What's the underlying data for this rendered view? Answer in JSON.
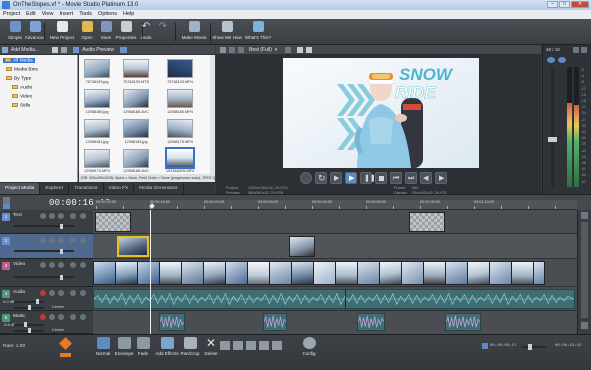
{
  "window": {
    "title": "OnTheSlopes.vf * - Movie Studio Platinum 13.0",
    "buttons": [
      "–",
      "□",
      "✕"
    ]
  },
  "menu": [
    "Project",
    "Edit",
    "View",
    "Insert",
    "Tools",
    "Options",
    "Help"
  ],
  "toolbar": {
    "items": [
      {
        "label": "Simple",
        "icon": "layout-simple-icon"
      },
      {
        "label": "Advanced",
        "icon": "layout-advanced-icon"
      },
      {
        "label": "New Project",
        "icon": "new-project-icon"
      },
      {
        "label": "Open",
        "icon": "open-folder-icon"
      },
      {
        "label": "Save",
        "icon": "save-icon"
      },
      {
        "label": "Properties",
        "icon": "properties-icon"
      },
      {
        "label": "Undo",
        "icon": "undo-icon"
      },
      {
        "label": "Make Movie",
        "icon": "make-movie-icon"
      },
      {
        "label": "Show Me How",
        "icon": "show-me-how-icon"
      },
      {
        "label": "What's This?",
        "icon": "help-icon"
      }
    ]
  },
  "media": {
    "add_media_label": "Add Media...",
    "audio_preview_label": "Audio Preview",
    "tree": [
      {
        "label": "All Media",
        "selected": true
      },
      {
        "label": "Media Bins",
        "selected": false
      },
      {
        "label": "By Type",
        "selected": false
      },
      {
        "label": "Audio",
        "selected": false
      },
      {
        "label": "Video",
        "selected": false
      },
      {
        "label": "Stills",
        "selected": false
      }
    ],
    "thumbnails": [
      "75748193.jpg",
      "75748193.MTS",
      "75748193.MP4",
      "12958185.jpg",
      "12958185.AVC",
      "12958185.MP4",
      "12958181.jpg",
      "12958183.jpg",
      "12958175.MP4",
      "12958174.MP4",
      "12958188.AVC",
      "10316480S.MP4"
    ],
    "info_line": "DIR: 400x400x32/IN, Alpha = None, Field Order = None (progressive scan), JPEG Quality",
    "tabs": [
      "Project Media",
      "Explorer",
      "Transitions",
      "Video FX",
      "Media Generators"
    ]
  },
  "preview": {
    "mode_label": "Best (Full)",
    "overlay_text_1": "SNOW",
    "overlay_text_2": "RIDE",
    "info": {
      "project_label": "Project:",
      "project_value": "1920x1080x32, 29.970i",
      "preview_label": "Preview:",
      "preview_value": "960x540x32, 29.970i",
      "frame_label": "Frame:",
      "frame_value": "960",
      "display_label": "Display:",
      "display_value": "294x165x32, 29.970"
    }
  },
  "master": {
    "label": "48 / 18",
    "scale": [
      "-3",
      "-6",
      "-9",
      "-12",
      "-15",
      "-18",
      "-21",
      "-24",
      "-27",
      "-30",
      "-33",
      "-36",
      "-39",
      "-42",
      "-45",
      "-48",
      "-51",
      "-54",
      "-57"
    ]
  },
  "timeline": {
    "timecode": "00:00:16;18",
    "ruler_labels": [
      "00:00:00;00",
      "00:00:10;00",
      "00:00:20;00",
      "00:00:30;00",
      "00:00:40;00",
      "00:00:50;00",
      "00:01:00;00",
      "00:01:10;00"
    ],
    "tracks": [
      {
        "num": "1",
        "name": "Text",
        "type": "video",
        "color": "#6a8fd1"
      },
      {
        "num": "2",
        "name": "",
        "type": "video",
        "color": "#6a8fd1"
      },
      {
        "num": "3",
        "name": "Video",
        "type": "video",
        "color": "#c25b8c"
      },
      {
        "num": "4",
        "name": "Audio",
        "type": "audio",
        "color": "#4a9a76",
        "vol": "0.0 dB",
        "pan": "Center"
      },
      {
        "num": "5",
        "name": "Music",
        "type": "audio",
        "color": "#4a9a76",
        "vol": "-5.6 dB",
        "pan": "Center"
      }
    ]
  },
  "bottom": {
    "rate": "Rate: 1.00",
    "tools": [
      {
        "label": "Normal",
        "icon": "normal-edit-icon"
      },
      {
        "label": "Envelope",
        "icon": "envelope-edit-icon"
      },
      {
        "label": "Fade",
        "icon": "fade-icon"
      },
      {
        "label": "Add Effects",
        "icon": "add-effects-icon"
      },
      {
        "label": "Pan/Crop",
        "icon": "pan-crop-icon"
      },
      {
        "label": "Delete",
        "icon": "delete-icon"
      },
      {
        "label": "Config",
        "icon": "config-icon"
      }
    ],
    "timecode_left": "00:00:08;17",
    "timecode_right": "00:00:19;15"
  }
}
